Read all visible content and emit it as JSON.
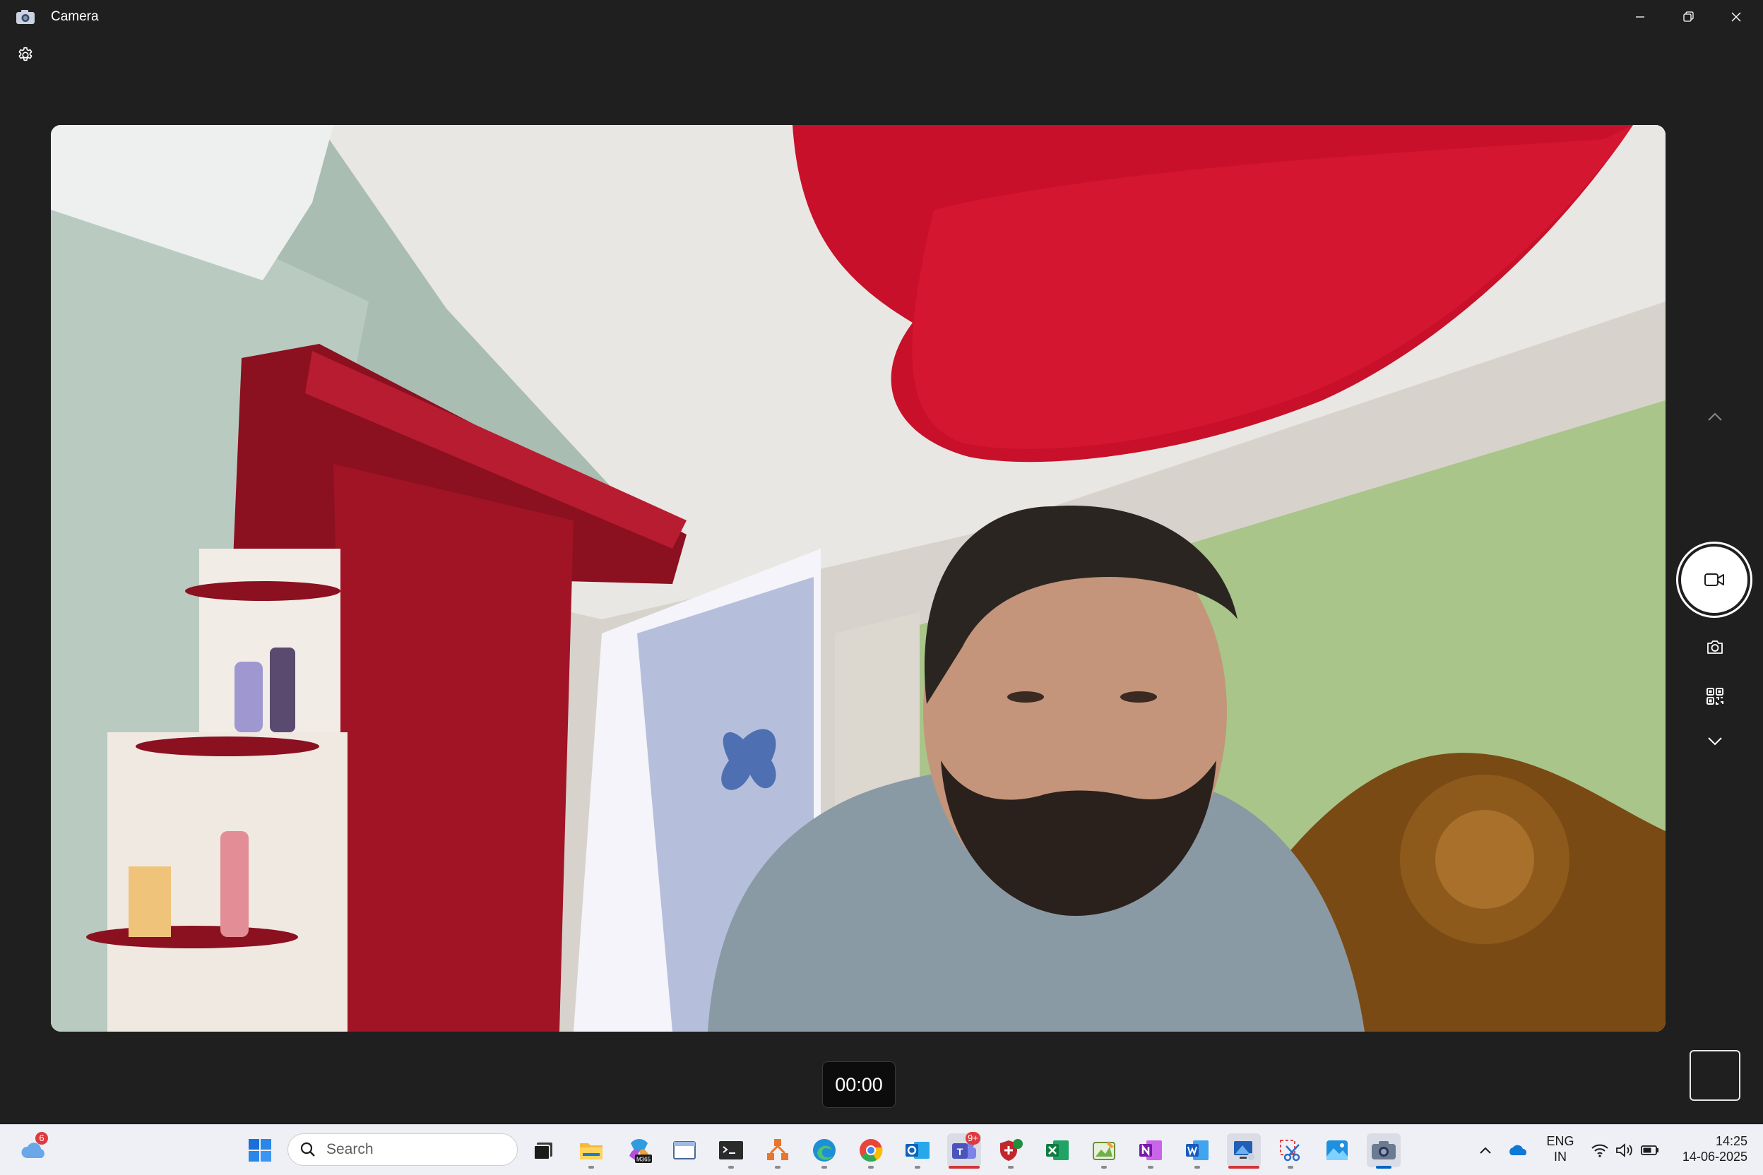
{
  "window": {
    "title": "Camera"
  },
  "preview": {
    "timer": "00:00"
  },
  "taskbar": {
    "weather_badge": "6",
    "search_placeholder": "Search",
    "teams_badge": "9+",
    "m365_label": "M365",
    "language_line1": "ENG",
    "language_line2": "IN",
    "time": "14:25",
    "date": "14-06-2025"
  },
  "colors": {
    "background": "#1f1f1f",
    "taskbar": "#eef0f5",
    "accent": "#0067c0"
  },
  "icons": [
    "camera-app-icon",
    "minimize-icon",
    "restore-icon",
    "close-icon",
    "settings-gear-icon",
    "chevron-up-icon",
    "video-camera-icon",
    "photo-camera-icon",
    "qr-code-icon",
    "chevron-down-icon",
    "weather-icon",
    "windows-start-icon",
    "search-icon",
    "task-view-icon",
    "file-explorer-icon",
    "m365-copilot-icon",
    "window-app-icon",
    "terminal-icon",
    "office-app-icon",
    "edge-icon",
    "chrome-icon",
    "outlook-icon",
    "teams-icon",
    "security-icon",
    "excel-icon",
    "paint-icon",
    "onenote-icon",
    "word-icon",
    "remote-app-icon",
    "snipping-tool-icon",
    "photos-icon",
    "camera-taskbar-icon",
    "show-hidden-icon",
    "onedrive-icon",
    "wifi-icon",
    "volume-icon",
    "battery-icon"
  ]
}
